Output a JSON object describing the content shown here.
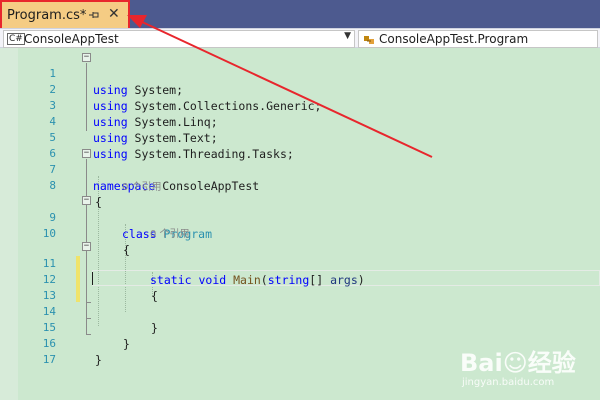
{
  "tab": {
    "title": "Program.cs*",
    "pin_glyph": "-ₐ",
    "close_glyph": "✕",
    "pin_icon": "pin-icon",
    "close_icon": "close-icon"
  },
  "navbar": {
    "project_dropdown": "ConsoleAppTest",
    "project_icon_text": "C#",
    "class_dropdown": "ConsoleAppTest.Program",
    "arrow_glyph": "▼"
  },
  "editor": {
    "line_numbers": [
      "1",
      "2",
      "3",
      "4",
      "5",
      "6",
      "7",
      "8",
      "9",
      "10",
      "11",
      "12",
      "13",
      "14",
      "15",
      "16",
      "17"
    ],
    "references": [
      "0 个引用",
      "0 个引用"
    ],
    "code": {
      "l1_kw": "using",
      "l1_rest": " System;",
      "l2_kw": "using",
      "l2_rest": " System.Collections.Generic;",
      "l3_kw": "using",
      "l3_rest": " System.Linq;",
      "l4_kw": "using",
      "l4_rest": " System.Text;",
      "l5_kw": "using",
      "l5_rest": " System.Threading.Tasks;",
      "l7_kw": "namespace",
      "l7_rest": " ConsoleAppTest",
      "l8": "{",
      "l9_kw": "class",
      "l9_type": " Program",
      "l10": "{",
      "l11_kw1": "static",
      "l11_kw2": " void",
      "l11_fn": " Main",
      "l11_p1": "(",
      "l11_kw3": "string",
      "l11_p2": "[] ",
      "l11_param": "args",
      "l11_p3": ")",
      "l12": "{",
      "l14": "}",
      "l15": "}",
      "l16": "}"
    },
    "colors": {
      "background": "#cce8cf",
      "keyword": "#0000ff",
      "type": "#2b91af",
      "line_number": "#2b91af",
      "change_marker": "#efe36b",
      "annotation": "#e8262d"
    }
  },
  "watermark": {
    "logo": "Bai☺经验",
    "url": "jingyan.baidu.com"
  }
}
